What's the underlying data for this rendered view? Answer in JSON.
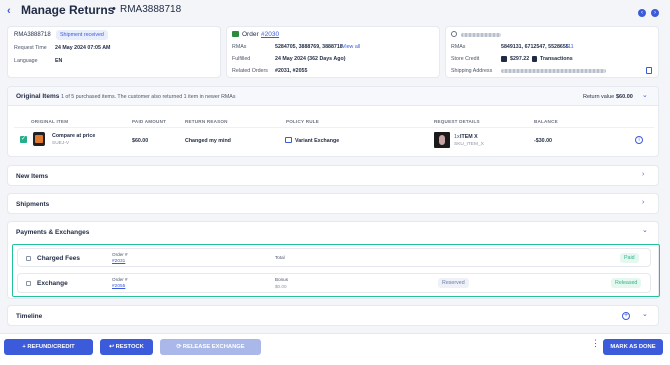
{
  "header": {
    "title": "Manage Returns",
    "separator": "•",
    "rma_id": "RMA3888718"
  },
  "summary": {
    "rma": "RMA3888718",
    "status_badge": "Shipment received",
    "request_time_label": "Request Time",
    "request_time": "24 May 2024 07:05 AM",
    "language_label": "Language",
    "language": "EN"
  },
  "order": {
    "title": "Order",
    "order_link": "#2030",
    "rmas_label": "RMAs",
    "rmas": "5284705, 3888769, 3888718",
    "view_all": "View all",
    "fulfilled_label": "Fulfilled",
    "fulfilled": "24 May 2024 (362 Days Ago)",
    "related_label": "Related Orders",
    "related": "#2031, #2055"
  },
  "customer": {
    "rmas_label": "RMAs",
    "rmas": "5849131, 6712547, 5528655",
    "rmas_more": "+11",
    "store_credit_label": "Store Credit",
    "store_credit": "$297.22",
    "transactions": "Transactions",
    "shipping_label": "Shipping Address"
  },
  "original_items": {
    "title": "Original Items",
    "description": "1 of 5 purchased items. The customer also returned 1 item in newer RMAs",
    "return_value_label": "Return value",
    "return_value": "$60.00",
    "columns": [
      "ORIGINAL ITEM",
      "PAID AMOUNT",
      "RETURN REASON",
      "POLICY RULE",
      "REQUEST DETAILS",
      "BALANCE"
    ],
    "row": {
      "name": "Compare at price",
      "sku": "SUEJ-V",
      "paid": "$60.00",
      "reason": "Changed my mind",
      "policy": "Variant Exchange",
      "request_qty": "1x",
      "request_item": "ITEM X",
      "request_sku": "SKU_ITEM_X",
      "balance": "-$30.00"
    }
  },
  "sections": {
    "new_items": "New Items",
    "shipments": "Shipments",
    "payments": "Payments & Exchanges",
    "timeline": "Timeline"
  },
  "payments": {
    "fees": {
      "title": "Charged Fees",
      "order_label": "Order #",
      "order_link": "#2031",
      "total_label": "Total",
      "status": "Paid"
    },
    "exchange": {
      "title": "Exchange",
      "order_label": "Order #",
      "order_link": "#2055",
      "bonus_label": "Bonus",
      "bonus_value": "$0.00",
      "reserved": "Reserved",
      "status": "Released"
    }
  },
  "footer": {
    "refund": "REFUND/CREDIT",
    "restock": "RESTOCK",
    "release_exchange": "RELEASE EXCHANGE",
    "mark_done": "MARK AS DONE"
  },
  "colors": {
    "accent": "#3b5bdb",
    "success": "#2bb58a",
    "highlight_border": "#22c39a",
    "disabled": "#a9b8e8"
  }
}
